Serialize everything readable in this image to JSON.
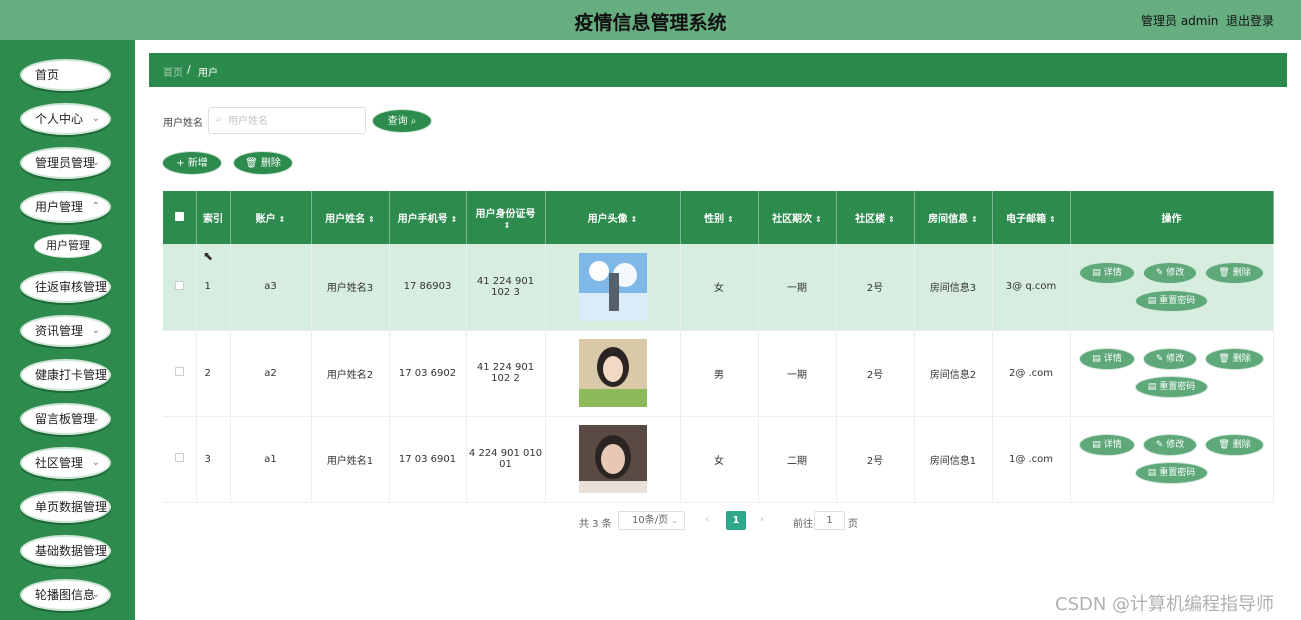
{
  "header": {
    "title": "疫情信息管理系统",
    "user": "管理员 admin",
    "logout": "退出登录"
  },
  "sidebar": {
    "items": [
      {
        "label": "首页",
        "chevron": ""
      },
      {
        "label": "个人中心",
        "chevron": "⌄"
      },
      {
        "label": "管理员管理",
        "chevron": "⌄"
      },
      {
        "label": "用户管理",
        "chevron": "⌃"
      },
      {
        "label": "往返审核管理",
        "chevron": "⌄"
      },
      {
        "label": "资讯管理",
        "chevron": "⌄"
      },
      {
        "label": "健康打卡管理",
        "chevron": "⌄"
      },
      {
        "label": "留言板管理",
        "chevron": "⌄"
      },
      {
        "label": "社区管理",
        "chevron": "⌄"
      },
      {
        "label": "单页数据管理",
        "chevron": "⌄"
      },
      {
        "label": "基础数据管理",
        "chevron": "⌄"
      },
      {
        "label": "轮播图信息",
        "chevron": "⌄"
      }
    ],
    "sub_item": "用户管理"
  },
  "breadcrumb": {
    "home": "首页",
    "sep": "/",
    "current": "用户"
  },
  "search": {
    "label": "用户姓名",
    "placeholder": "用户姓名",
    "value": "",
    "query_button": "查询 ⌕"
  },
  "actions": {
    "add": "+ 新增",
    "delete": "🗑 删除"
  },
  "table": {
    "headers": {
      "index": "索引",
      "account": "账户",
      "name": "用户姓名",
      "phone": "用户手机号",
      "id_card": "用户身份证号",
      "avatar": "用户头像",
      "gender": "性别",
      "phase": "社区期次",
      "building": "社区楼",
      "room": "房间信息",
      "email": "电子邮箱",
      "ops": "操作"
    },
    "rows": [
      {
        "index": "1",
        "account": "a3",
        "name": "用户姓名3",
        "phone": "17  86903",
        "id_card": "41 224 901 102 3",
        "gender": "女",
        "phase": "一期",
        "building": "2号",
        "room": "房间信息3",
        "email": "3@ q.com",
        "highlight": true
      },
      {
        "index": "2",
        "account": "a2",
        "name": "用户姓名2",
        "phone": "17 03 6902",
        "id_card": "41 224 901 102 2",
        "gender": "男",
        "phase": "一期",
        "building": "2号",
        "room": "房间信息2",
        "email": "2@ .com",
        "highlight": false
      },
      {
        "index": "3",
        "account": "a1",
        "name": "用户姓名1",
        "phone": "17 03 6901",
        "id_card": "4 224 901 010 01",
        "gender": "女",
        "phase": "二期",
        "building": "2号",
        "room": "房间信息1",
        "email": "1@ .com",
        "highlight": false
      }
    ],
    "ops": {
      "detail": "详情",
      "edit": "修改",
      "delete": "删除",
      "reset": "重置密码"
    }
  },
  "pager": {
    "total": "共 3 条",
    "size": "10条/页",
    "current": "1",
    "goto": "前往",
    "goto_value": "1",
    "unit": "页"
  },
  "watermark": "CSDN @计算机编程指导师"
}
